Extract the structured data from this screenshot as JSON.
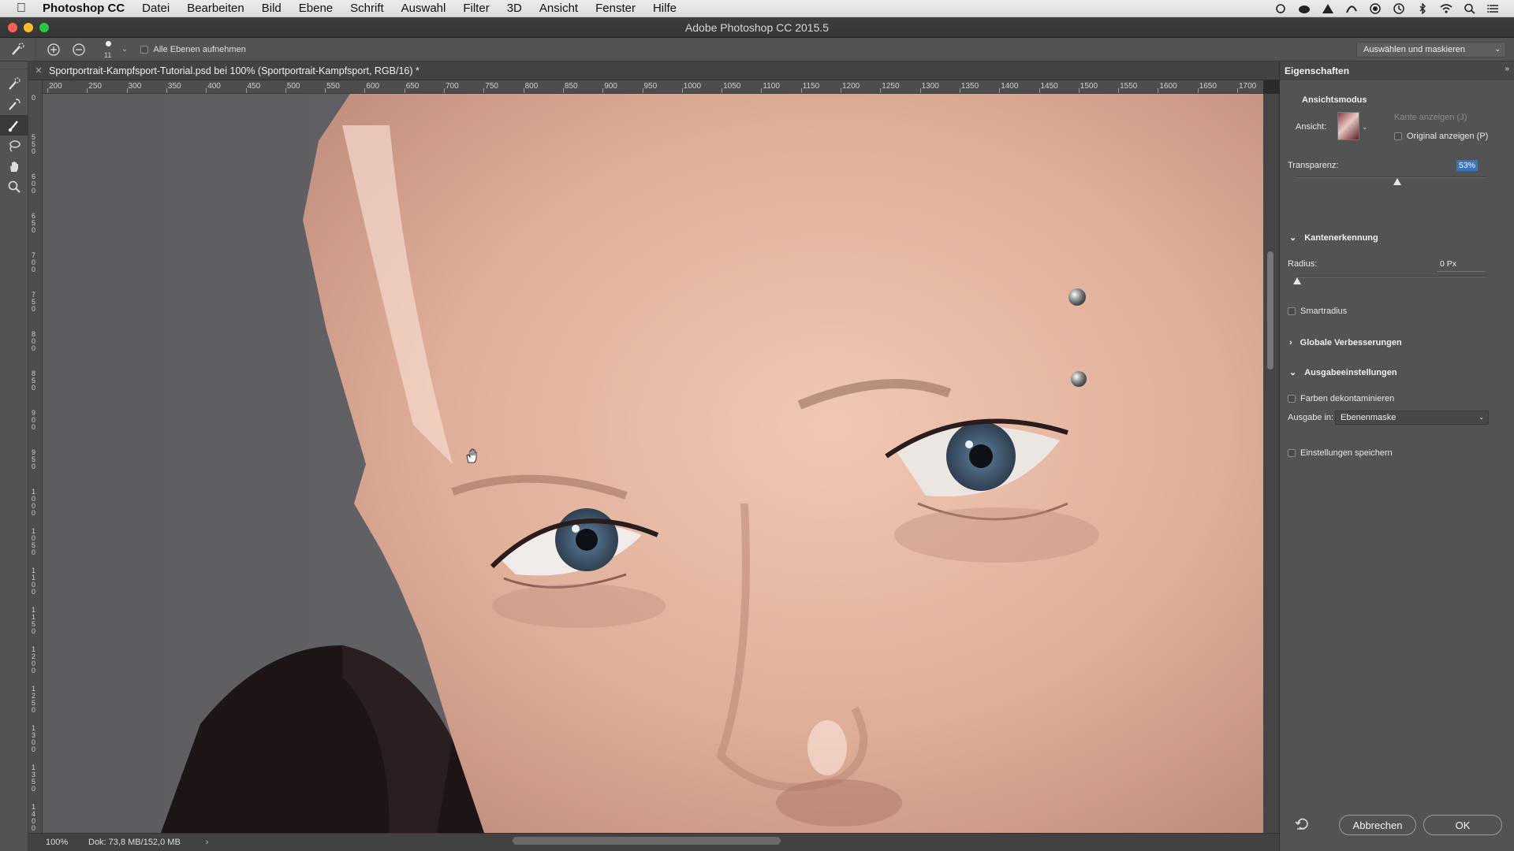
{
  "menubar": {
    "app_name": "Photoshop CC",
    "items": [
      "Datei",
      "Bearbeiten",
      "Bild",
      "Ebene",
      "Schrift",
      "Auswahl",
      "Filter",
      "3D",
      "Ansicht",
      "Fenster",
      "Hilfe"
    ]
  },
  "window": {
    "title": "Adobe Photoshop CC 2015.5"
  },
  "options_bar": {
    "brush_size": "11",
    "sample_all_layers_label": "Alle Ebenen aufnehmen",
    "workspace_dropdown": "Auswählen und maskieren"
  },
  "document": {
    "tab_title": "Sportportrait-Kampfsport-Tutorial.psd bei 100% (Sportportrait-Kampfsport, RGB/16) *",
    "ruler_top_labels": [
      "200",
      "250",
      "300",
      "350",
      "400",
      "450",
      "500",
      "550",
      "600",
      "650",
      "700",
      "750",
      "800",
      "850",
      "900",
      "950",
      "1000",
      "1050",
      "1100",
      "1150",
      "1200",
      "1250",
      "1300",
      "1350",
      "1400",
      "1450",
      "1500",
      "1550",
      "1600",
      "1650",
      "1700"
    ],
    "ruler_left_labels": [
      "0",
      "550",
      "600",
      "650",
      "700",
      "750",
      "800",
      "850",
      "900",
      "950",
      "1000",
      "1050",
      "1100",
      "1150",
      "1200",
      "1250",
      "1300",
      "1350",
      "1400"
    ]
  },
  "status": {
    "zoom": "100%",
    "doc_info": "Dok: 73,8 MB/152,0 MB"
  },
  "properties": {
    "panel_title": "Eigenschaften",
    "view_mode_title": "Ansichtsmodus",
    "view_label": "Ansicht:",
    "show_edge": "Kante anzeigen (J)",
    "show_original": "Original anzeigen (P)",
    "transparency_label": "Transparenz:",
    "transparency_value": "53%",
    "transparency_fraction": 0.53,
    "edge_detection_title": "Kantenerkennung",
    "radius_label": "Radius:",
    "radius_value": "0 Px",
    "radius_fraction": 0.0,
    "smart_radius": "Smartradius",
    "global_refinements": "Globale Verbesserungen",
    "output_settings_title": "Ausgabeeinstellungen",
    "decontaminate_colors": "Farben dekontaminieren",
    "output_to_label": "Ausgabe in:",
    "output_to_value": "Ebenenmaske",
    "remember_settings": "Einstellungen speichern",
    "cancel_label": "Abbrechen",
    "ok_label": "OK"
  }
}
